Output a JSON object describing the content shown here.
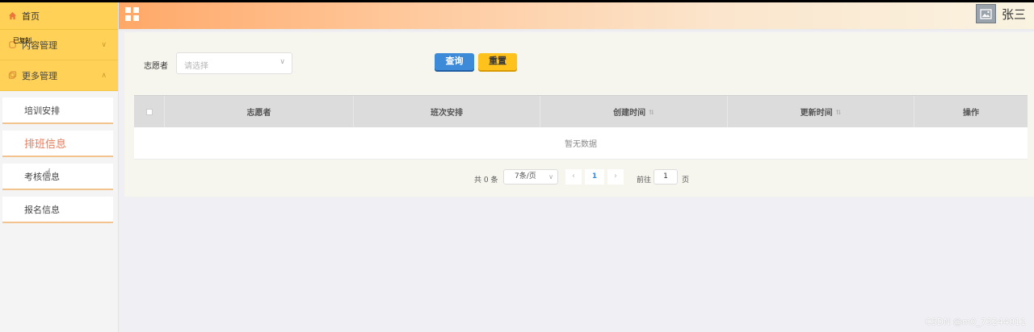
{
  "sidebar": {
    "home_label": "首页",
    "overlay_text": "已复制",
    "groups": [
      {
        "label": "内容管理",
        "expanded": false
      },
      {
        "label": "更多管理",
        "expanded": true
      }
    ],
    "items": [
      {
        "label": "培训安排"
      },
      {
        "label": "排班信息"
      },
      {
        "label": "考核信息"
      },
      {
        "label": "报名信息"
      }
    ],
    "active_item": "排班信息",
    "accent_color": "#ffd257"
  },
  "header": {
    "menu_icon": "grid-icon",
    "avatar_icon": "image-icon",
    "username": "张三"
  },
  "search": {
    "label": "志愿者",
    "placeholder": "请选择",
    "query_button": "查询",
    "reset_button": "重置"
  },
  "table": {
    "columns": [
      {
        "label": "",
        "type": "checkbox"
      },
      {
        "label": "志愿者"
      },
      {
        "label": "班次安排"
      },
      {
        "label": "创建时间",
        "sortable": true
      },
      {
        "label": "更新时间",
        "sortable": true
      },
      {
        "label": "操作"
      }
    ],
    "empty_text": "暂无数据"
  },
  "pagination": {
    "total_text": "共 0 条",
    "page_size": "7条/页",
    "current_page": "1",
    "goto_label": "前往",
    "goto_value": "1",
    "page_unit": "页"
  },
  "watermark": "CSDN @m0_73244011"
}
